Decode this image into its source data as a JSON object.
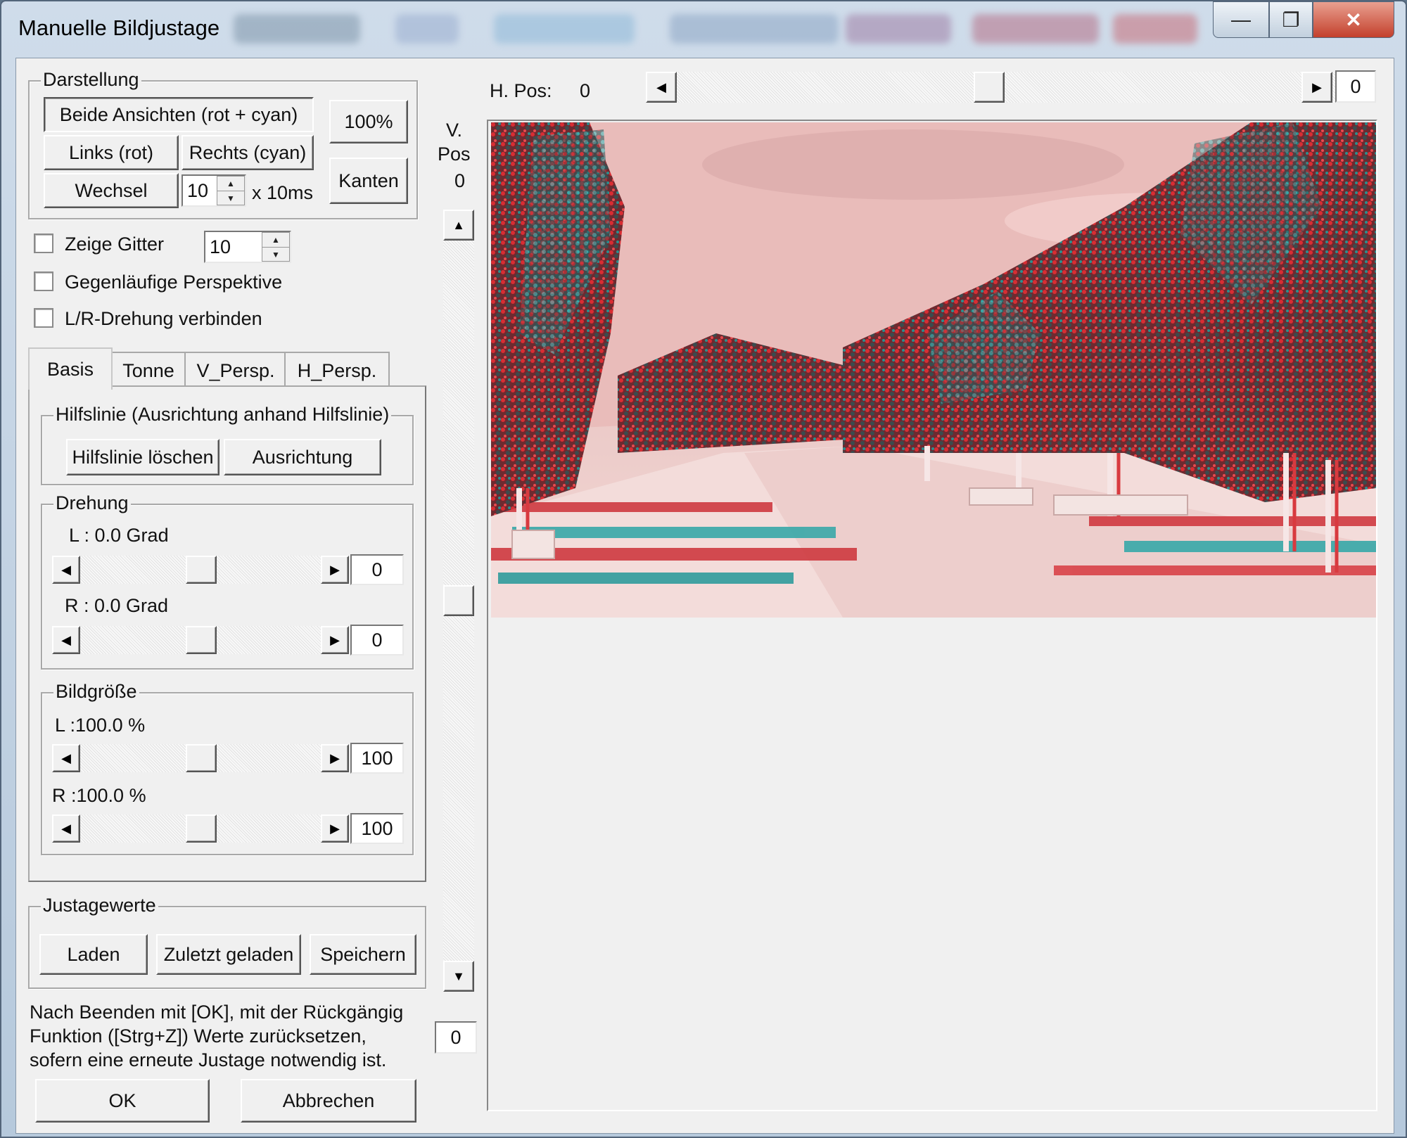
{
  "window": {
    "title": "Manuelle Bildjustage",
    "minimize": "—",
    "maximize": "❐",
    "close": "✕"
  },
  "darstellung": {
    "label": "Darstellung",
    "beide": "Beide Ansichten (rot + cyan)",
    "links": "Links (rot)",
    "rechts": "Rechts (cyan)",
    "wechsel": "Wechsel",
    "wechsel_value": "10",
    "wechsel_unit": "x 10ms",
    "zoom": "100%",
    "kanten": "Kanten"
  },
  "options": {
    "zeige_gitter": "Zeige Gitter",
    "gitter_value": "10",
    "gegenlaeufig": "Gegenläufige Perspektive",
    "lr_drehung": "L/R-Drehung verbinden"
  },
  "tabs": [
    {
      "label": "Basis"
    },
    {
      "label": "Tonne"
    },
    {
      "label": "V_Persp."
    },
    {
      "label": "H_Persp."
    }
  ],
  "hilfslinie": {
    "label": "Hilfslinie (Ausrichtung anhand Hilfslinie)",
    "loeschen": "Hilfslinie löschen",
    "ausrichtung": "Ausrichtung"
  },
  "drehung": {
    "label": "Drehung",
    "l_label": "L : 0.0 Grad",
    "l_value": "0",
    "r_label": "R : 0.0 Grad",
    "r_value": "0"
  },
  "bildgroesse": {
    "label": "Bildgröße",
    "l_label": "L :100.0 %",
    "l_value": "100",
    "r_label": "R :100.0 %",
    "r_value": "100"
  },
  "justagewerte": {
    "label": "Justagewerte",
    "laden": "Laden",
    "zuletzt": "Zuletzt geladen",
    "speichern": "Speichern"
  },
  "hint": {
    "line1": "Nach Beenden mit [OK], mit der Rückgängig",
    "line2": "Funktion ([Strg+Z]) Werte zurücksetzen,",
    "line3": "sofern eine erneute Justage notwendig ist."
  },
  "footer": {
    "ok": "OK",
    "cancel": "Abbrechen"
  },
  "hpos": {
    "label": "H. Pos:",
    "value": "0",
    "box": "0"
  },
  "vpos": {
    "label1": "V.",
    "label2": "Pos",
    "value": "0",
    "box": "0"
  },
  "icons": {
    "left": "◀",
    "right": "▶",
    "up": "▲",
    "down": "▼",
    "spin_up": "▲",
    "spin_down": "▼"
  }
}
